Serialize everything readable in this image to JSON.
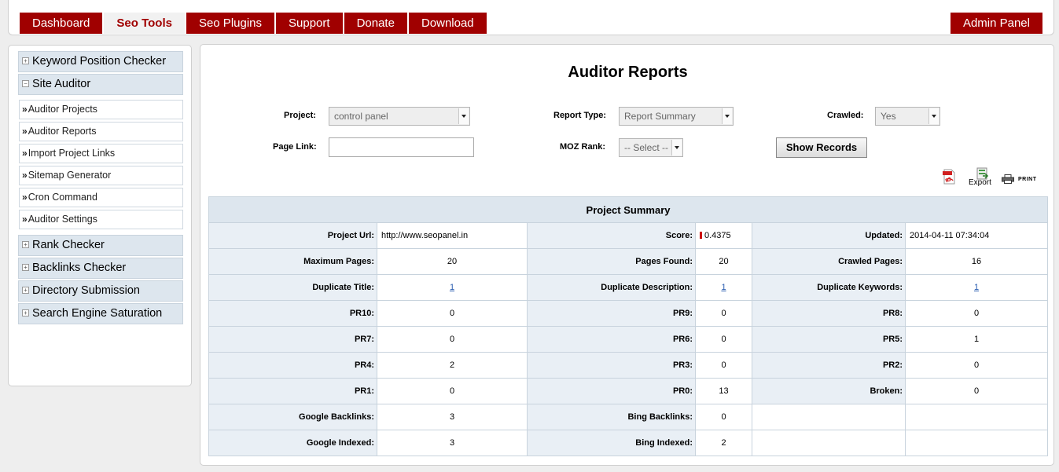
{
  "nav": {
    "tabs": [
      {
        "label": "Dashboard",
        "active": false
      },
      {
        "label": "Seo Tools",
        "active": true
      },
      {
        "label": "Seo Plugins",
        "active": false
      },
      {
        "label": "Support",
        "active": false
      },
      {
        "label": "Donate",
        "active": false
      },
      {
        "label": "Download",
        "active": false
      }
    ],
    "admin_label": "Admin Panel"
  },
  "sidebar": {
    "groups": [
      {
        "label": "Keyword Position Checker",
        "expanded": false
      },
      {
        "label": "Site Auditor",
        "expanded": true
      },
      {
        "label": "Rank Checker",
        "expanded": false
      },
      {
        "label": "Backlinks Checker",
        "expanded": false
      },
      {
        "label": "Directory Submission",
        "expanded": false
      },
      {
        "label": "Search Engine Saturation",
        "expanded": false
      }
    ],
    "site_auditor_items": [
      "Auditor Projects",
      "Auditor Reports",
      "Import Project Links",
      "Sitemap Generator",
      "Cron Command",
      "Auditor Settings"
    ]
  },
  "main": {
    "title": "Auditor Reports",
    "filters": {
      "project_label": "Project:",
      "project_value": "control panel",
      "report_type_label": "Report Type:",
      "report_type_value": "Report Summary",
      "crawled_label": "Crawled:",
      "crawled_value": "Yes",
      "page_link_label": "Page Link:",
      "page_link_value": "",
      "moz_rank_label": "MOZ Rank:",
      "moz_rank_value": "-- Select --",
      "show_button": "Show Records"
    },
    "actions": {
      "export_label": "Export",
      "print_label": "PRINT"
    },
    "summary": {
      "title": "Project Summary",
      "rows": [
        [
          {
            "label": "Project Url:",
            "value": "http://www.seopanel.in"
          },
          {
            "label": "Score:",
            "value": "0.4375"
          },
          {
            "label": "Updated:",
            "value": "2014-04-11 07:34:04"
          }
        ],
        [
          {
            "label": "Maximum Pages:",
            "value": "20"
          },
          {
            "label": "Pages Found:",
            "value": "20"
          },
          {
            "label": "Crawled Pages:",
            "value": "16"
          }
        ],
        [
          {
            "label": "Duplicate Title:",
            "value": "1"
          },
          {
            "label": "Duplicate Description:",
            "value": "1"
          },
          {
            "label": "Duplicate Keywords:",
            "value": "1"
          }
        ],
        [
          {
            "label": "PR10:",
            "value": "0"
          },
          {
            "label": "PR9:",
            "value": "0"
          },
          {
            "label": "PR8:",
            "value": "0"
          }
        ],
        [
          {
            "label": "PR7:",
            "value": "0"
          },
          {
            "label": "PR6:",
            "value": "0"
          },
          {
            "label": "PR5:",
            "value": "1"
          }
        ],
        [
          {
            "label": "PR4:",
            "value": "2"
          },
          {
            "label": "PR3:",
            "value": "0"
          },
          {
            "label": "PR2:",
            "value": "0"
          }
        ],
        [
          {
            "label": "PR1:",
            "value": "0"
          },
          {
            "label": "PR0:",
            "value": "13"
          },
          {
            "label": "Broken:",
            "value": "0"
          }
        ],
        [
          {
            "label": "Google Backlinks:",
            "value": "3"
          },
          {
            "label": "Bing Backlinks:",
            "value": "0"
          }
        ],
        [
          {
            "label": "Google Indexed:",
            "value": "3"
          },
          {
            "label": "Bing Indexed:",
            "value": "2"
          }
        ]
      ]
    }
  },
  "colors": {
    "brand_red": "#a00000",
    "panel_blue": "#dde6ee",
    "link_blue": "#2a5db0"
  }
}
